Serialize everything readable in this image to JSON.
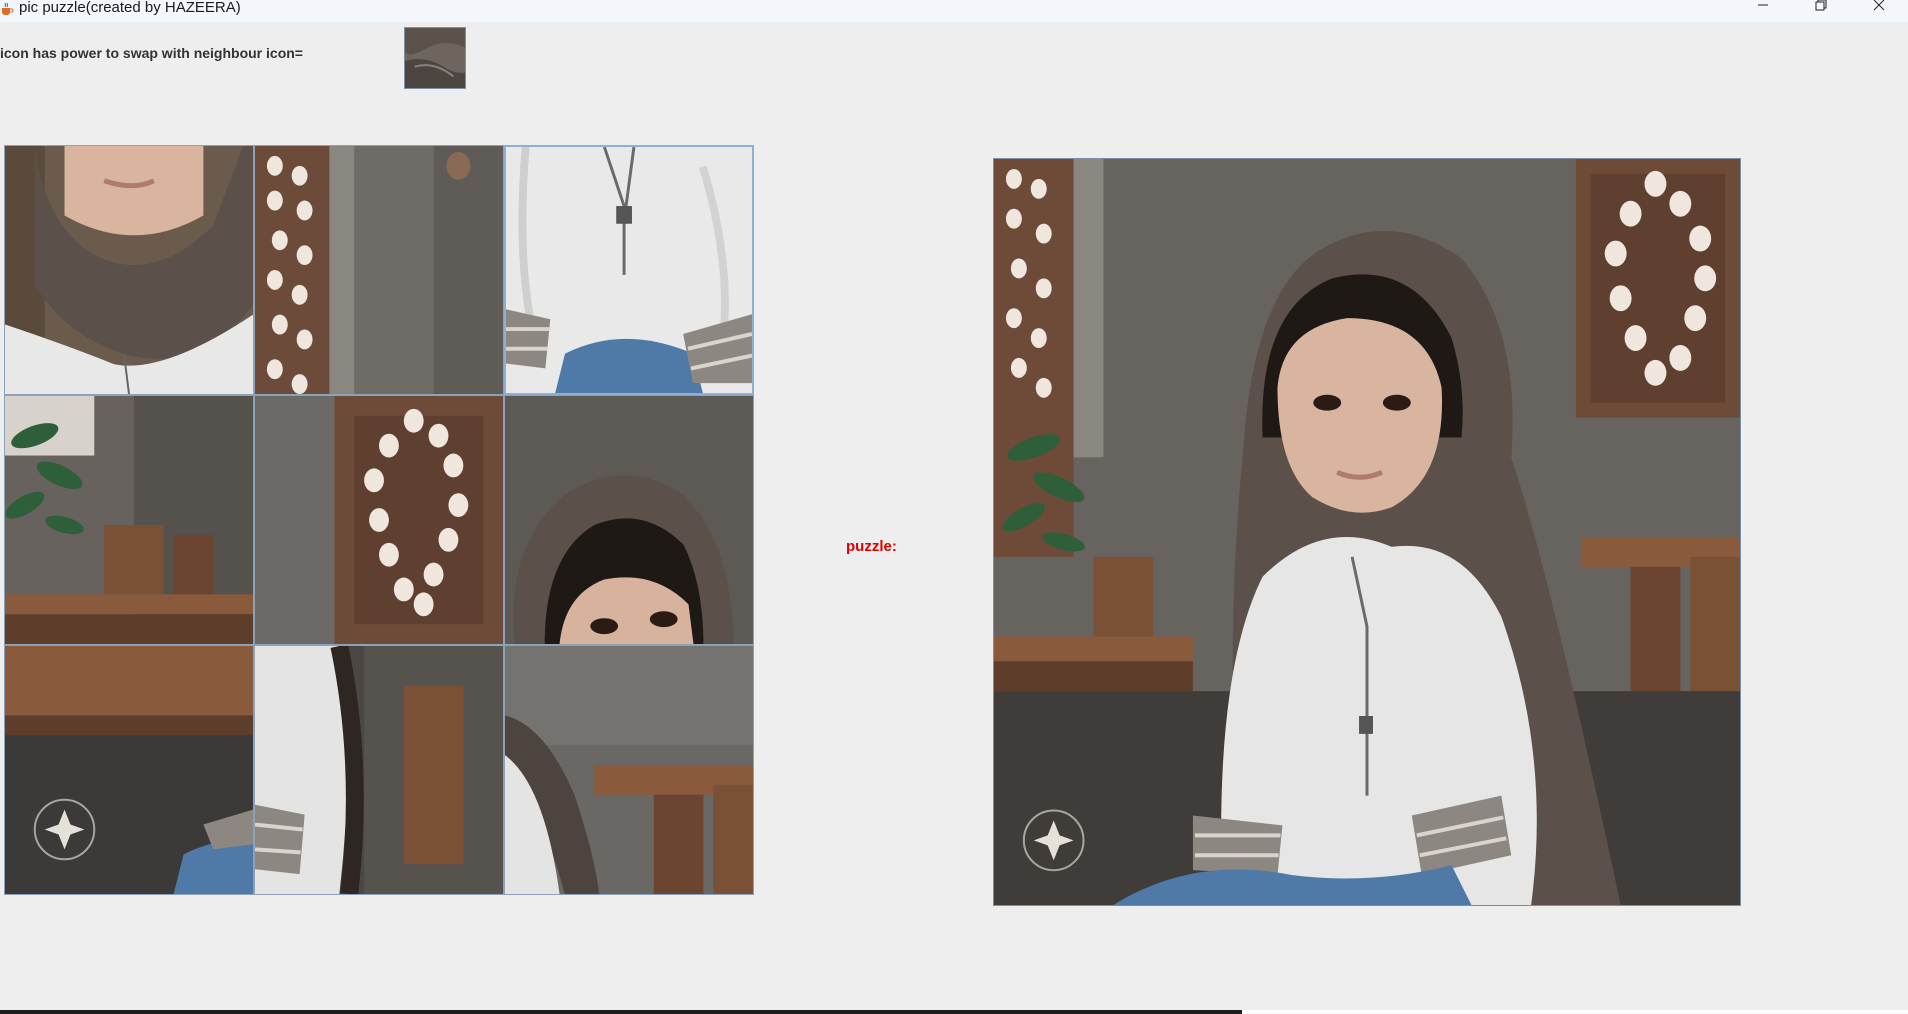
{
  "window": {
    "title": "pic puzzle(created by HAZEERA)",
    "icon": "java-coffee-cup-icon",
    "controls": {
      "minimize_icon": "minimize-icon",
      "maximize_icon": "restore-icon",
      "close_icon": "close-icon"
    }
  },
  "hint": {
    "label": "icon has power to swap with neighbour icon="
  },
  "puzzle": {
    "label": "puzzle:",
    "label_color": "#e00000",
    "grid_size": 3,
    "tiles": [
      {
        "piece": "girl-chin-scarf"
      },
      {
        "piece": "lattice-wall-left"
      },
      {
        "piece": "shirt-necklace"
      },
      {
        "piece": "plant-table"
      },
      {
        "piece": "lattice-wall-right"
      },
      {
        "piece": "girl-eyes"
      },
      {
        "piece": "table-watermark"
      },
      {
        "piece": "sleeve-chair"
      },
      {
        "piece": "scarf-chair"
      }
    ],
    "selected_tile": 2
  },
  "reference": {
    "description_icon": "completed-puzzle-image"
  },
  "colors": {
    "window_bg": "#eeeeee",
    "titlebar_bg": "#f3f6fb",
    "tile_border": "#8da2b9",
    "selected_border": "#8faed1",
    "accent_red": "#e00000"
  }
}
